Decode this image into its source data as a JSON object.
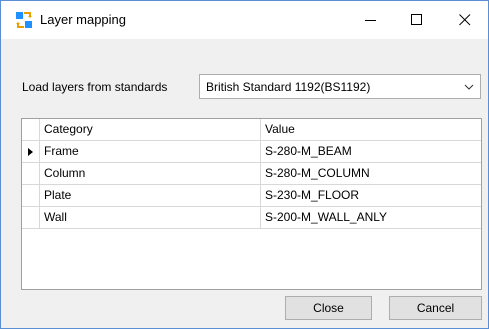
{
  "window": {
    "title": "Layer mapping",
    "minimize_glyph": "—",
    "maximize_glyph": "☐",
    "close_glyph": "✕"
  },
  "load": {
    "label": "Load layers from standards",
    "selected_standard": "British Standard 1192(BS1192)"
  },
  "grid": {
    "columns": [
      "Category",
      "Value"
    ],
    "rows": [
      {
        "category": "Frame",
        "value": "S-280-M_BEAM",
        "current": true
      },
      {
        "category": "Column",
        "value": "S-280-M_COLUMN",
        "current": false
      },
      {
        "category": "Plate",
        "value": "S-230-M_FLOOR",
        "current": false
      },
      {
        "category": "Wall",
        "value": "S-200-M_WALL_ANLY",
        "current": false
      }
    ]
  },
  "buttons": {
    "close_label": "Close",
    "cancel_label": "Cancel"
  },
  "icons": {
    "app": "layer-mapping-icon",
    "row_pointer": "row-pointer-icon",
    "dropdown": "chevron-down-icon"
  }
}
